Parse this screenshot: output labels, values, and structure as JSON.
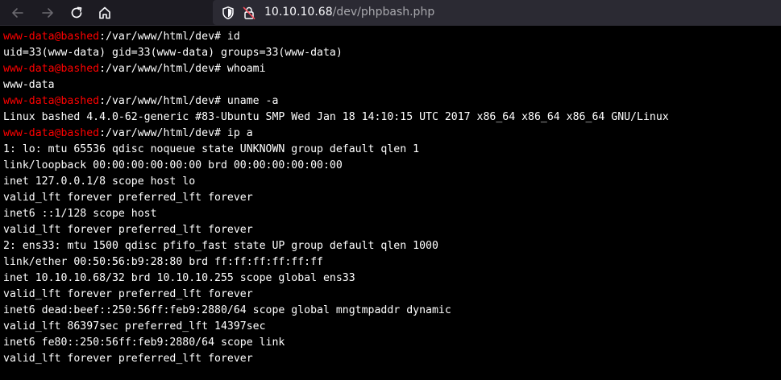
{
  "browser": {
    "url_host": "10.10.10.68",
    "url_path": "/dev/phpbash.php",
    "icons": {
      "back": "arrow-left-icon",
      "forward": "arrow-right-icon",
      "reload": "reload-icon",
      "home": "home-icon",
      "tracking": "shield-icon",
      "security": "insecure-lock-icon"
    },
    "colors": {
      "toolbar_bg": "#1c1b22",
      "urlbar_bg": "#2b2a33"
    }
  },
  "terminal": {
    "colors": {
      "background": "#000000",
      "prompt_user": "#ff0000",
      "text": "#ffffff"
    },
    "lines": [
      {
        "type": "prompt",
        "user": "www-data@bashed",
        "path": ":/var/www/html/dev# ",
        "cmd": "id"
      },
      {
        "type": "output",
        "text": "uid=33(www-data) gid=33(www-data) groups=33(www-data)"
      },
      {
        "type": "prompt",
        "user": "www-data@bashed",
        "path": ":/var/www/html/dev# ",
        "cmd": "whoami"
      },
      {
        "type": "output",
        "text": "www-data"
      },
      {
        "type": "prompt",
        "user": "www-data@bashed",
        "path": ":/var/www/html/dev# ",
        "cmd": "uname -a"
      },
      {
        "type": "output",
        "text": "Linux bashed 4.4.0-62-generic #83-Ubuntu SMP Wed Jan 18 14:10:15 UTC 2017 x86_64 x86_64 x86_64 GNU/Linux"
      },
      {
        "type": "prompt",
        "user": "www-data@bashed",
        "path": ":/var/www/html/dev# ",
        "cmd": "ip a"
      },
      {
        "type": "output",
        "text": "1: lo: mtu 65536 qdisc noqueue state UNKNOWN group default qlen 1"
      },
      {
        "type": "output",
        "text": "link/loopback 00:00:00:00:00:00 brd 00:00:00:00:00:00"
      },
      {
        "type": "output",
        "text": "inet 127.0.0.1/8 scope host lo"
      },
      {
        "type": "output",
        "text": "valid_lft forever preferred_lft forever"
      },
      {
        "type": "output",
        "text": "inet6 ::1/128 scope host"
      },
      {
        "type": "output",
        "text": "valid_lft forever preferred_lft forever"
      },
      {
        "type": "output",
        "text": "2: ens33: mtu 1500 qdisc pfifo_fast state UP group default qlen 1000"
      },
      {
        "type": "output",
        "text": "link/ether 00:50:56:b9:28:80 brd ff:ff:ff:ff:ff:ff"
      },
      {
        "type": "output",
        "text": "inet 10.10.10.68/32 brd 10.10.10.255 scope global ens33"
      },
      {
        "type": "output",
        "text": "valid_lft forever preferred_lft forever"
      },
      {
        "type": "output",
        "text": "inet6 dead:beef::250:56ff:feb9:2880/64 scope global mngtmpaddr dynamic"
      },
      {
        "type": "output",
        "text": "valid_lft 86397sec preferred_lft 14397sec"
      },
      {
        "type": "output",
        "text": "inet6 fe80::250:56ff:feb9:2880/64 scope link"
      },
      {
        "type": "output",
        "text": "valid_lft forever preferred_lft forever"
      }
    ]
  }
}
